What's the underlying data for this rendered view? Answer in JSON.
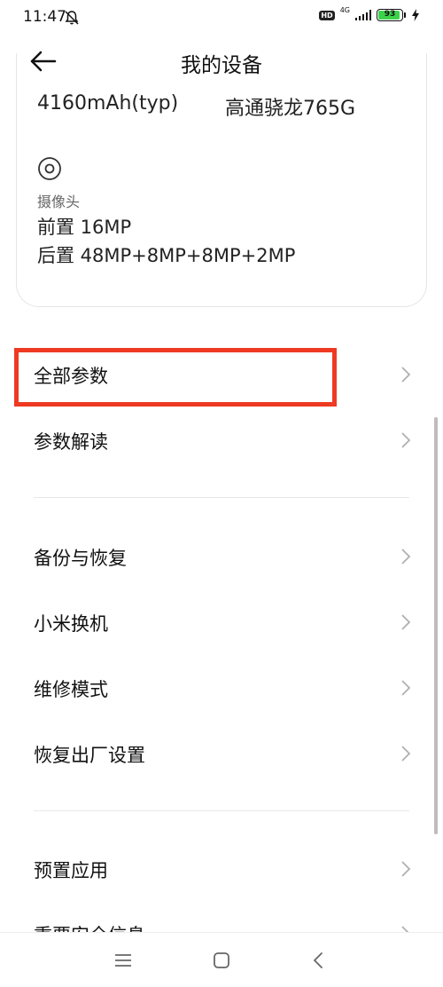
{
  "status_bar": {
    "time": "11:47",
    "hd": "HD",
    "network": "4G",
    "battery_level": "93",
    "battery_fraction": 0.93,
    "battery_color": "#3cd24a",
    "icons": [
      "mute-bell-icon",
      "signal-icon",
      "battery-icon",
      "charging-bolt-icon"
    ]
  },
  "header": {
    "title": "我的设备",
    "back_icon": "back-arrow-icon"
  },
  "device_card": {
    "battery": "4160mAh(typ)",
    "processor": "高通骁龙765G",
    "camera_icon": "camera-icon",
    "camera_label": "摄像头",
    "camera_front": "前置 16MP",
    "camera_rear": "后置 48MP+8MP+8MP+2MP"
  },
  "menu": {
    "all_params": "全部参数",
    "param_explain": "参数解读",
    "backup_restore": "备份与恢复",
    "mi_mover": "小米换机",
    "repair_mode": "维修模式",
    "factory_reset": "恢复出厂设置",
    "preinstalled_apps": "预置应用",
    "important_safety": "重要安全信息"
  },
  "annotation": {
    "highlight_color": "#ee3a22"
  },
  "nav_bar": {
    "icons": [
      "menu-icon",
      "home-icon",
      "back-icon"
    ]
  }
}
